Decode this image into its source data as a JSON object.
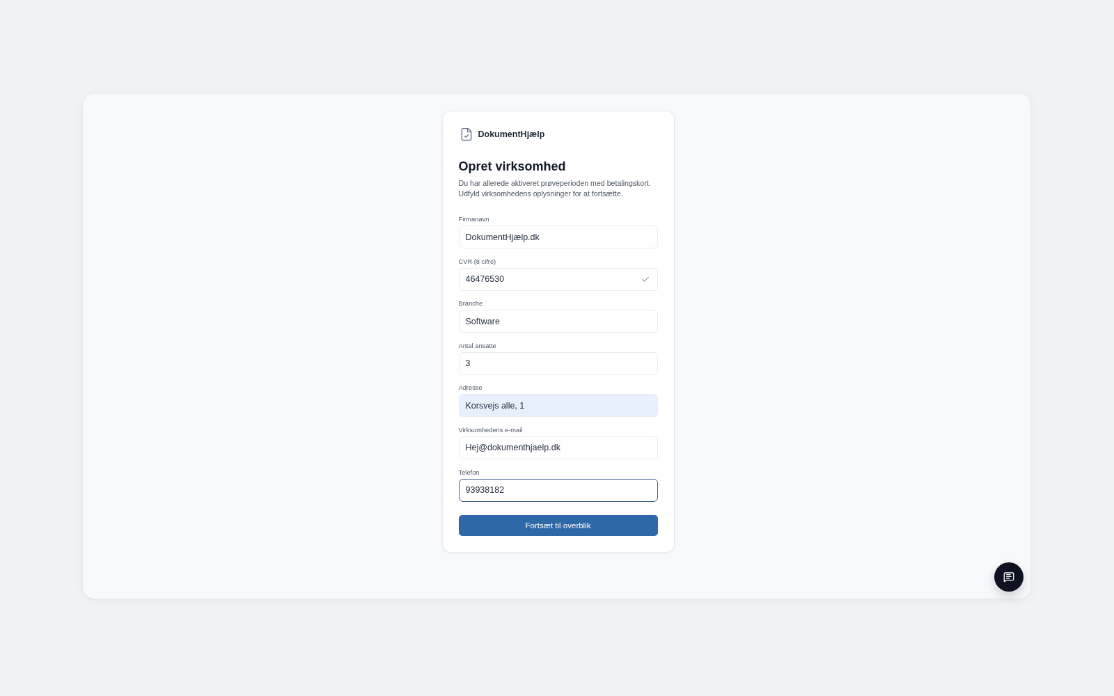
{
  "brand": {
    "name": "DokumentHjælp"
  },
  "heading": {
    "title": "Opret virksomhed",
    "description": "Du har allerede aktiveret prøveperioden med betalingskort. Udfyld virksomhedens oplysninger for at fortsætte."
  },
  "form": {
    "fields": [
      {
        "label": "Firmanavn",
        "value": "DokumentHjælp.dk",
        "verified": false,
        "autofilled": false,
        "focused": false
      },
      {
        "label": "CVR (8 cifre)",
        "value": "46476530",
        "verified": true,
        "autofilled": false,
        "focused": false
      },
      {
        "label": "Branche",
        "value": "Software",
        "verified": false,
        "autofilled": false,
        "focused": false
      },
      {
        "label": "Antal ansatte",
        "value": "3",
        "verified": false,
        "autofilled": false,
        "focused": false
      },
      {
        "label": "Adresse",
        "value": "Korsvejs alle, 1",
        "verified": false,
        "autofilled": true,
        "focused": false
      },
      {
        "label": "Virksomhedens e-mail",
        "value": "Hej@dokumenthjaelp.dk",
        "verified": false,
        "autofilled": false,
        "focused": false
      },
      {
        "label": "Telefon",
        "value": "93938182",
        "verified": false,
        "autofilled": false,
        "focused": true
      }
    ],
    "submit_button": {
      "label": "Fortsæt til overblik"
    }
  }
}
